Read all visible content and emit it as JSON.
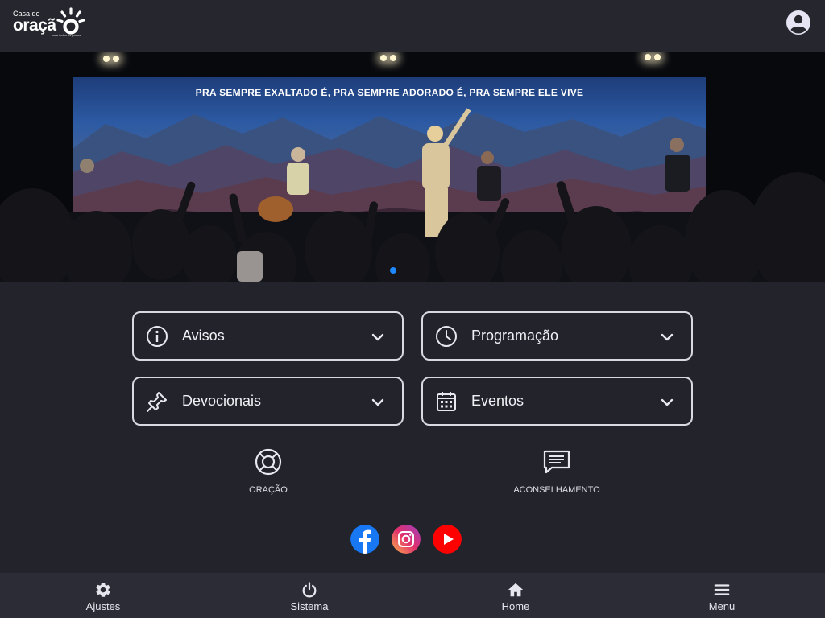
{
  "header": {
    "logo_small": "Casa de",
    "logo_big": "oraçã",
    "logo_tag": "para todos os povos"
  },
  "banner": {
    "lyric": "PRA SEMPRE EXALTADO É, PRA SEMPRE ADORADO É, PRA SEMPRE ELE VIVE",
    "slide_indicator_color": "#1e88ff"
  },
  "cards": {
    "avisos": {
      "label": "Avisos",
      "icon": "info-icon"
    },
    "programacao": {
      "label": "Programação",
      "icon": "clock-icon"
    },
    "devocionais": {
      "label": "Devocionais",
      "icon": "pin-icon"
    },
    "eventos": {
      "label": "Eventos",
      "icon": "calendar-icon"
    }
  },
  "shortcuts": {
    "oracao": {
      "label": "ORAÇÃO",
      "icon": "lifebuoy-icon"
    },
    "aconselhamento": {
      "label": "ACONSELHAMENTO",
      "icon": "chat-icon"
    }
  },
  "social": {
    "facebook_color": "#1877f2",
    "youtube_color": "#ff0000"
  },
  "bottom_nav": {
    "ajustes": {
      "label": "Ajustes",
      "icon": "gear-icon"
    },
    "sistema": {
      "label": "Sistema",
      "icon": "power-icon"
    },
    "home": {
      "label": "Home",
      "icon": "home-icon"
    },
    "menu": {
      "label": "Menu",
      "icon": "menu-icon"
    }
  },
  "colors": {
    "background": "#22232b",
    "header": "#25262e",
    "bottom_nav": "#2b2c35",
    "card_border": "#d9d9e2"
  }
}
